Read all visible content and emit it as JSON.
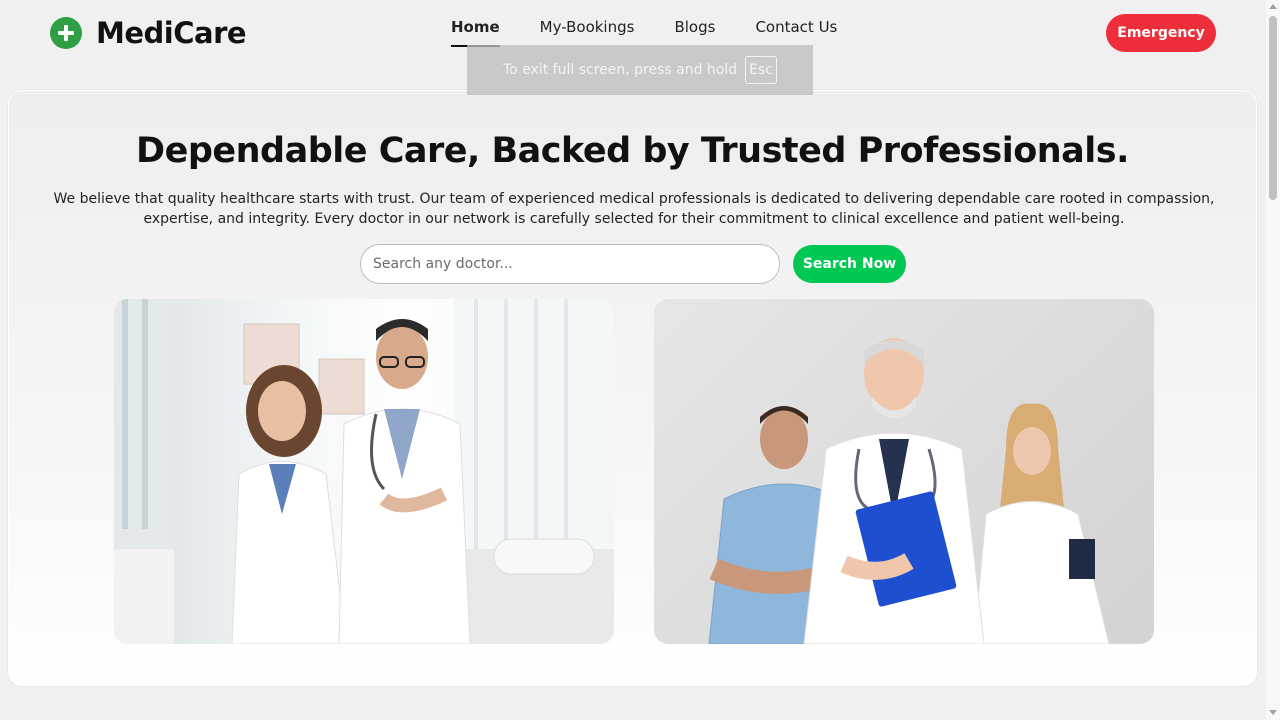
{
  "header": {
    "logo_icon": "plus-circle-icon",
    "logo_text": "MediCare",
    "nav": [
      {
        "label": "Home",
        "active": true
      },
      {
        "label": "My-Bookings",
        "active": false
      },
      {
        "label": "Blogs",
        "active": false
      },
      {
        "label": "Contact Us",
        "active": false
      }
    ],
    "emergency_label": "Emergency"
  },
  "fullscreen_toast": {
    "text": "To exit full screen, press and hold",
    "key": "Esc"
  },
  "hero": {
    "title": "Dependable Care, Backed by Trusted Professionals.",
    "description": "We believe that quality healthcare starts with trust. Our team of experienced medical professionals is dedicated to delivering dependable care rooted in compassion, expertise, and integrity. Every doctor in our network is carefully selected for their commitment to clinical excellence and patient well-being.",
    "search_placeholder": "Search any doctor...",
    "search_button": "Search Now"
  },
  "colors": {
    "brand_green": "#2ea043",
    "emergency_red": "#ee2e3b",
    "search_green": "#00c853",
    "page_bg": "#f0f0f0"
  }
}
